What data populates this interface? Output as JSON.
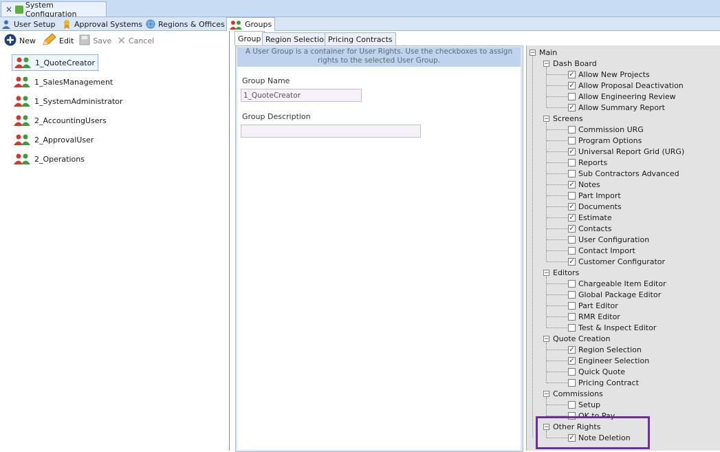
{
  "window": {
    "tab_title": "System Configuration"
  },
  "modules": [
    {
      "label": "User Setup"
    },
    {
      "label": "Approval Systems"
    },
    {
      "label": "Regions & Offices"
    },
    {
      "label": "Groups"
    }
  ],
  "toolbar": {
    "new": "New",
    "edit": "Edit",
    "save": "Save",
    "cancel": "Cancel"
  },
  "groups": [
    {
      "label": "1_QuoteCreator",
      "selected": true
    },
    {
      "label": "1_SalesManagement"
    },
    {
      "label": "1_SystemAdministrator"
    },
    {
      "label": "2_AccountingUsers"
    },
    {
      "label": "2_ApprovalUser"
    },
    {
      "label": "2_Operations"
    }
  ],
  "subtabs": [
    {
      "label": "Group"
    },
    {
      "label": "Region Selection"
    },
    {
      "label": "Pricing Contracts"
    }
  ],
  "info_text": "A User Group is a container for User Rights. Use the checkboxes to assign rights to the selected User Group.",
  "form": {
    "name_label": "Group Name",
    "name_value": "1_QuoteCreator",
    "desc_label": "Group Description",
    "desc_value": ""
  },
  "tree": {
    "root": "Main",
    "sections": [
      {
        "label": "Dash Board",
        "items": [
          {
            "label": "Allow New Projects",
            "checked": true
          },
          {
            "label": "Allow Proposal Deactivation",
            "checked": true
          },
          {
            "label": "Allow Engineering Review",
            "checked": false
          },
          {
            "label": "Allow Summary Report",
            "checked": true
          }
        ]
      },
      {
        "label": "Screens",
        "items": [
          {
            "label": "Commission URG",
            "checked": false
          },
          {
            "label": "Program Options",
            "checked": false
          },
          {
            "label": "Universal Report Grid (URG)",
            "checked": true
          },
          {
            "label": "Reports",
            "checked": false
          },
          {
            "label": "Sub Contractors Advanced",
            "checked": false
          },
          {
            "label": "Notes",
            "checked": true
          },
          {
            "label": "Part Import",
            "checked": false
          },
          {
            "label": "Documents",
            "checked": true
          },
          {
            "label": "Estimate",
            "checked": true
          },
          {
            "label": "Contacts",
            "checked": true
          },
          {
            "label": "User Configuration",
            "checked": false
          },
          {
            "label": "Contact Import",
            "checked": false
          },
          {
            "label": "Customer Configurator",
            "checked": true
          }
        ]
      },
      {
        "label": "Editors",
        "items": [
          {
            "label": "Chargeable Item Editor",
            "checked": false
          },
          {
            "label": "Global Package Editor",
            "checked": false
          },
          {
            "label": "Part Editor",
            "checked": false
          },
          {
            "label": "RMR Editor",
            "checked": false
          },
          {
            "label": "Test & Inspect Editor",
            "checked": false
          }
        ]
      },
      {
        "label": "Quote Creation",
        "items": [
          {
            "label": "Region Selection",
            "checked": true
          },
          {
            "label": "Engineer Selection",
            "checked": true
          },
          {
            "label": "Quick Quote",
            "checked": false
          },
          {
            "label": "Pricing Contract",
            "checked": false
          }
        ]
      },
      {
        "label": "Commissions",
        "items": [
          {
            "label": "Setup",
            "checked": false
          },
          {
            "label": "OK to Pay",
            "checked": false
          }
        ]
      },
      {
        "label": "Other Rights",
        "items": [
          {
            "label": "Note Deletion",
            "checked": true
          }
        ]
      }
    ]
  },
  "colors": {
    "highlight": "#6b2fa0",
    "accent": "#c9def5"
  }
}
